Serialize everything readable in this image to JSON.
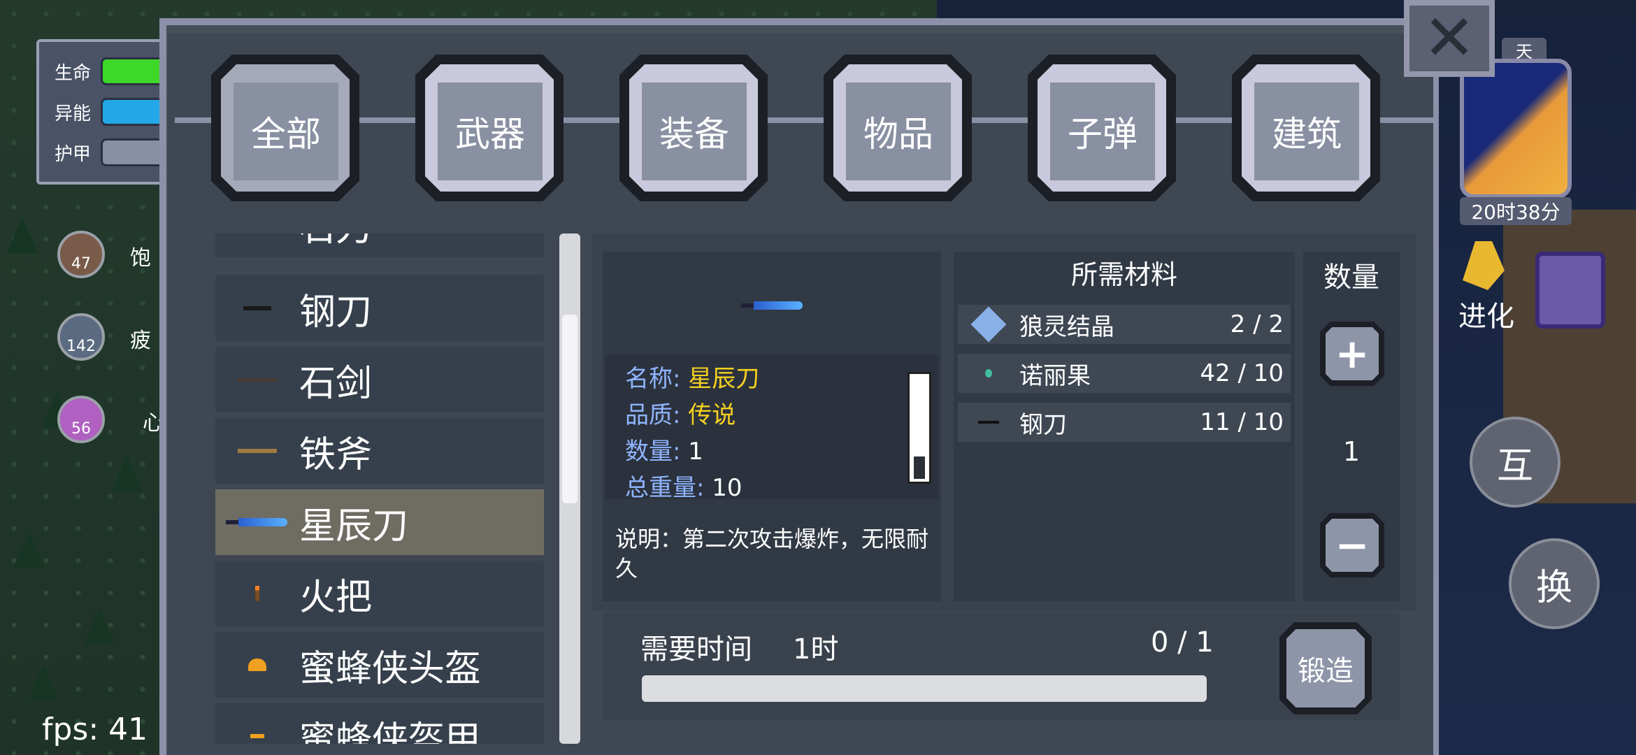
{
  "hud": {
    "stats": [
      {
        "label": "生命",
        "color": "#3ed82a"
      },
      {
        "label": "异能",
        "color": "#22a8e8"
      },
      {
        "label": "护甲",
        "color": "#8a90a4"
      }
    ],
    "status": [
      {
        "icon": "hunger-icon",
        "value": "47",
        "side": "饱"
      },
      {
        "icon": "fatigue-icon",
        "value": "142",
        "side": "疲"
      },
      {
        "icon": "heart-icon",
        "value": "56",
        "side": "心"
      }
    ],
    "fps": "fps: 41",
    "clock_time": "20时38分",
    "clock_day": "天",
    "evolve_label": "进化",
    "interact_label": "互",
    "swap_label": "换"
  },
  "tabs": [
    {
      "label": "全部",
      "active": true
    },
    {
      "label": "武器",
      "active": false
    },
    {
      "label": "装备",
      "active": false
    },
    {
      "label": "物品",
      "active": false
    },
    {
      "label": "子弹",
      "active": false
    },
    {
      "label": "建筑",
      "active": false
    }
  ],
  "list": {
    "items": [
      {
        "label": "石刀",
        "icon": "stone-knife-icon"
      },
      {
        "label": "钢刀",
        "icon": "steel-knife-icon"
      },
      {
        "label": "石剑",
        "icon": "stone-sword-icon"
      },
      {
        "label": "铁斧",
        "icon": "iron-axe-icon"
      },
      {
        "label": "星辰刀",
        "icon": "star-blade-icon",
        "selected": true
      },
      {
        "label": "火把",
        "icon": "torch-icon"
      },
      {
        "label": "蜜蜂侠头盔",
        "icon": "bee-helmet-icon"
      },
      {
        "label": "蜜蜂侠盔甲",
        "icon": "bee-armor-icon"
      }
    ]
  },
  "detail": {
    "name_label": "名称:",
    "name_value": "星辰刀",
    "quality_label": "品质:",
    "quality_value": "传说",
    "count_label": "数量:",
    "count_value": "1",
    "weight_label": "总重量:",
    "weight_value": "10",
    "description": "说明：第二次攻击爆炸，无限耐久"
  },
  "materials": {
    "title": "所需材料",
    "rows": [
      {
        "name": "狼灵结晶",
        "count": "2 / 2",
        "icon": "wolf-crystal-icon"
      },
      {
        "name": "诺丽果",
        "count": "42 / 10",
        "icon": "noni-fruit-icon"
      },
      {
        "name": "钢刀",
        "count": "11 / 10",
        "icon": "steel-knife-icon"
      }
    ]
  },
  "quantity": {
    "title": "数量",
    "value": "1",
    "plus": "+",
    "minus": "−"
  },
  "craft": {
    "time_label": "需要时间",
    "time_value": "1时",
    "progress_text": "0 / 1",
    "progress": 0,
    "forge_label": "锻造"
  },
  "close_symbol": "✕"
}
